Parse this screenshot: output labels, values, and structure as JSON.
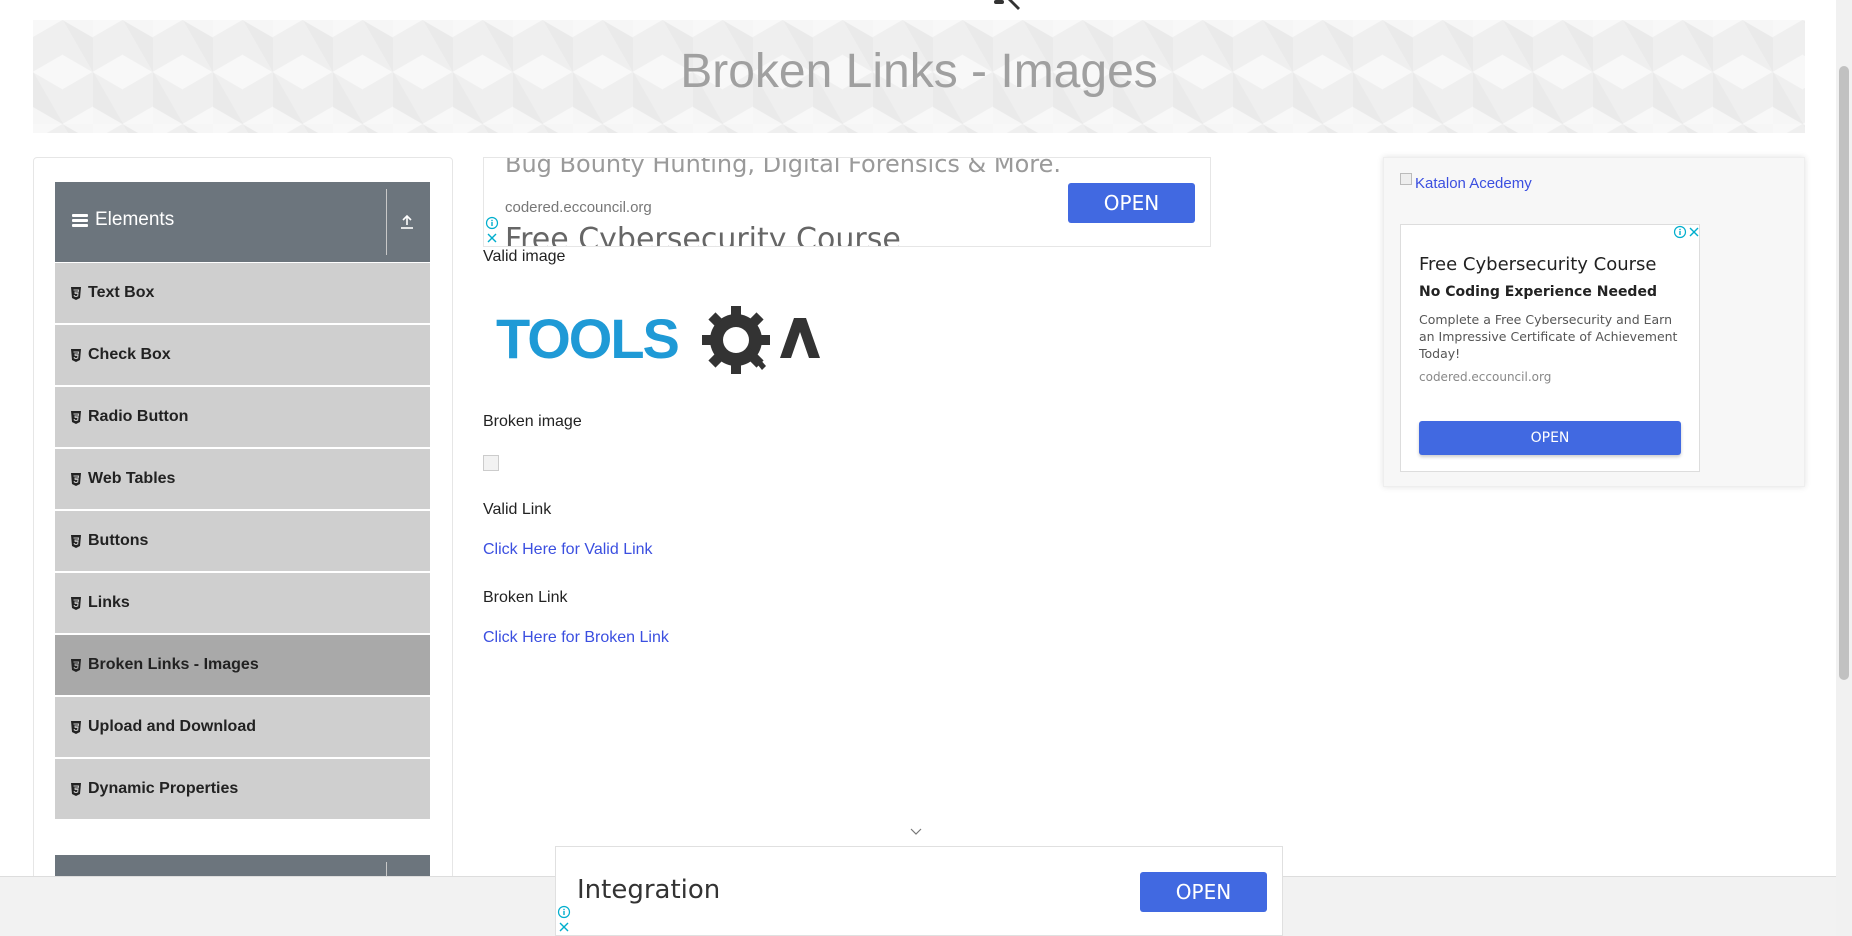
{
  "page": {
    "title": "Broken Links - Images"
  },
  "sidebar": {
    "group_title": "Elements",
    "items": [
      {
        "label": "Text Box"
      },
      {
        "label": "Check Box"
      },
      {
        "label": "Radio Button"
      },
      {
        "label": "Web Tables"
      },
      {
        "label": "Buttons"
      },
      {
        "label": "Links"
      },
      {
        "label": "Broken Links - Images",
        "active": true
      },
      {
        "label": "Upload and Download"
      },
      {
        "label": "Dynamic Properties"
      }
    ]
  },
  "ad_top": {
    "line1": "Bug Bounty Hunting, Digital Forensics & More.",
    "domain": "codered.eccouncil.org",
    "line2": "Free Cybersecurity Course",
    "button": "OPEN"
  },
  "main": {
    "valid_image_label": "Valid image",
    "logo_text": "TOOLSQA",
    "broken_image_label": "Broken image",
    "valid_link_label": "Valid Link",
    "valid_link_text": "Click Here for Valid Link",
    "broken_link_label": "Broken Link",
    "broken_link_text": "Click Here for Broken Link"
  },
  "ad_right": {
    "alt_text": "Katalon Acedemy",
    "title": "Free Cybersecurity Course",
    "subtitle": "No Coding Experience Needed",
    "body": "Complete a Free Cybersecurity and Earn an Impressive Certificate of Achievement Today!",
    "domain": "codered.eccouncil.org",
    "button": "OPEN"
  },
  "ad_bottom": {
    "text": "Integration",
    "button": "OPEN"
  },
  "colors": {
    "accent": "#4169e1",
    "sidebar_header": "#6c757d",
    "menu_item": "#cfcfcf",
    "menu_item_active": "#a9a9a9",
    "link": "#3b4fe0"
  }
}
